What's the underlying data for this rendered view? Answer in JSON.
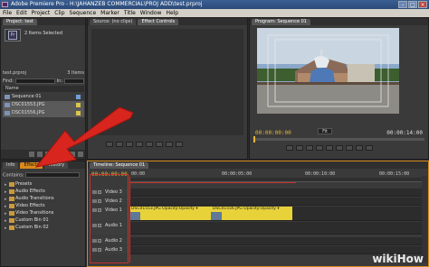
{
  "window": {
    "title": "Adobe Premiere Pro - H:\\JAHANZEB COMMERCIAL\\PROJ ADD\\test.prproj"
  },
  "menu": [
    "File",
    "Edit",
    "Project",
    "Clip",
    "Sequence",
    "Marker",
    "Title",
    "Window",
    "Help"
  ],
  "project": {
    "tab": "Project: test",
    "selected_text": "2 Items Selected",
    "project_name": "test.prproj",
    "item_count": "3 Items",
    "find_label": "Find:",
    "in_label": "In:",
    "column_header": "Name",
    "items": [
      {
        "name": "Sequence 01",
        "label_color": "#6fa0d8",
        "selected": false
      },
      {
        "name": "DSC01553.JPG",
        "label_color": "#d9c64a",
        "selected": true
      },
      {
        "name": "DSC01556.JPG",
        "label_color": "#d9c64a",
        "selected": true
      }
    ]
  },
  "source": {
    "tabs": [
      "Source: (no clips)",
      "Effect Controls"
    ]
  },
  "program": {
    "tab": "Program: Sequence 01",
    "timecode_left": "00:00:00:00",
    "timecode_right": "00:00:14:00",
    "fit_label": "Fit"
  },
  "effects": {
    "tabs": [
      "Info",
      "Effects",
      "History"
    ],
    "contains_label": "Contains:",
    "folders": [
      "Presets",
      "Audio Effects",
      "Audio Transitions",
      "Video Effects",
      "Video Transitions",
      "Custom Bin 01",
      "Custom Bin 02"
    ]
  },
  "timeline": {
    "tab": "Timeline: Sequence 01",
    "timecode": "00:00:00:00",
    "ruler_labels": [
      "00:00",
      "00:00:05:00",
      "00:00:10:00",
      "00:00:15:00"
    ],
    "tracks": [
      "Video 3",
      "Video 2",
      "Video 1",
      "Audio 1",
      "Audio 2",
      "Audio 3"
    ],
    "clips": [
      {
        "label": "DSC01553.JPG  Opacity:Opacity ▾"
      },
      {
        "label": "DSC01556.JPG  Opacity:Opacity ▾"
      }
    ]
  },
  "colors": {
    "accent_orange": "#d88a1c",
    "timecode_yellow": "#e6b83a",
    "video_clip": "#e8d23a",
    "arrow_red": "#d8261f"
  },
  "watermark": "wikiHow"
}
